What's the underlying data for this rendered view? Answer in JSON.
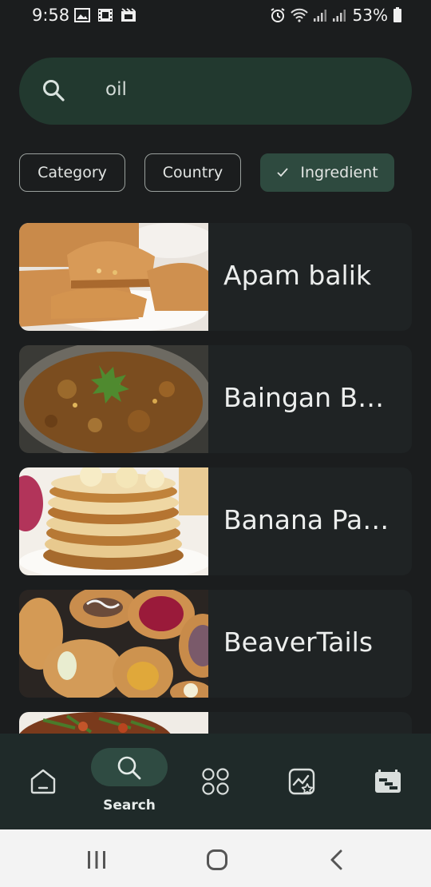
{
  "status_bar": {
    "time": "9:58",
    "battery": "53%",
    "left_icons": [
      "image-icon",
      "video-icon",
      "media-icon"
    ],
    "right_icons": [
      "alarm-icon",
      "wifi-icon",
      "signal-icon",
      "signal-icon",
      "battery-icon"
    ]
  },
  "search": {
    "value": "oil",
    "icon": "search-icon"
  },
  "filters": {
    "category": "Category",
    "country": "Country",
    "ingredient": "Ingredient",
    "selected": "Ingredient"
  },
  "results": [
    {
      "title": "Apam balik"
    },
    {
      "title": "Baingan Bharta"
    },
    {
      "title": "Banana Pancakes"
    },
    {
      "title": "BeaverTails"
    },
    {
      "title": ""
    }
  ],
  "bottom_nav": {
    "items": [
      {
        "icon": "home-icon"
      },
      {
        "icon": "search-icon",
        "label": "Search",
        "active": true
      },
      {
        "icon": "categories-icon"
      },
      {
        "icon": "favorites-icon"
      },
      {
        "icon": "planner-icon"
      }
    ]
  },
  "colors": {
    "background": "#1b1d1e",
    "search_bg": "#22392f",
    "chip_selected": "#2e4a3f",
    "nav_bg": "#1f2a29",
    "nav_pill": "#2f4b42"
  }
}
